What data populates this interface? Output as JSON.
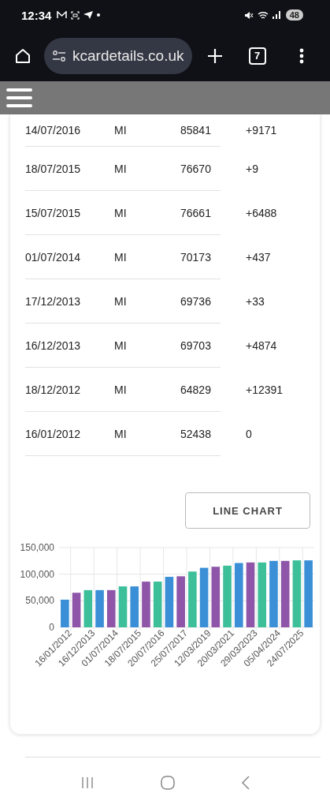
{
  "status_bar": {
    "time": "12:34",
    "battery": "48"
  },
  "browser": {
    "url": "kcardetails.co.uk",
    "tab_count": "7"
  },
  "table": {
    "rows": [
      {
        "date": "14/07/2016",
        "unit": "MI",
        "mileage": "85841",
        "change": "+9171"
      },
      {
        "date": "18/07/2015",
        "unit": "MI",
        "mileage": "76670",
        "change": "+9"
      },
      {
        "date": "15/07/2015",
        "unit": "MI",
        "mileage": "76661",
        "change": "+6488"
      },
      {
        "date": "01/07/2014",
        "unit": "MI",
        "mileage": "70173",
        "change": "+437"
      },
      {
        "date": "17/12/2013",
        "unit": "MI",
        "mileage": "69736",
        "change": "+33"
      },
      {
        "date": "16/12/2013",
        "unit": "MI",
        "mileage": "69703",
        "change": "+4874"
      },
      {
        "date": "18/12/2012",
        "unit": "MI",
        "mileage": "64829",
        "change": "+12391"
      },
      {
        "date": "16/01/2012",
        "unit": "MI",
        "mileage": "52438",
        "change": "0"
      }
    ]
  },
  "chart_button": "LINE CHART",
  "chart": {
    "chart_data": {
      "type": "bar",
      "categories": [
        "16/01/2012",
        null,
        "16/12/2013",
        null,
        "01/07/2014",
        null,
        "18/07/2015",
        null,
        "20/07/2016",
        null,
        "25/07/2017",
        null,
        "12/03/2019",
        null,
        "20/03/2021",
        null,
        "29/03/2023",
        null,
        "05/04/2024",
        null,
        "24/07/2025",
        null
      ],
      "series": [
        {
          "color": "#3a8fd6",
          "values": [
            52000,
            null,
            null,
            70000,
            null,
            null,
            77000,
            null,
            null,
            95000,
            null,
            null,
            112000,
            null,
            null,
            121000,
            null,
            null,
            125000,
            null,
            null,
            126000
          ]
        },
        {
          "color": "#8e55a8",
          "values": [
            null,
            65000,
            null,
            null,
            70000,
            null,
            null,
            86000,
            null,
            null,
            96000,
            null,
            null,
            114000,
            null,
            null,
            122000,
            null,
            null,
            125000,
            null,
            null
          ]
        },
        {
          "color": "#3dbf9a",
          "values": [
            null,
            null,
            70000,
            null,
            null,
            77000,
            null,
            null,
            86000,
            null,
            null,
            105000,
            null,
            null,
            116000,
            null,
            null,
            122000,
            null,
            null,
            126000,
            null
          ]
        }
      ],
      "grid": true,
      "ylim": [
        0,
        150000
      ],
      "yticks": [
        {
          "value": 0,
          "label": "0"
        },
        {
          "value": 50000,
          "label": "50,000"
        },
        {
          "value": 100000,
          "label": "100,000"
        },
        {
          "value": 150000,
          "label": "150,000"
        }
      ]
    }
  }
}
